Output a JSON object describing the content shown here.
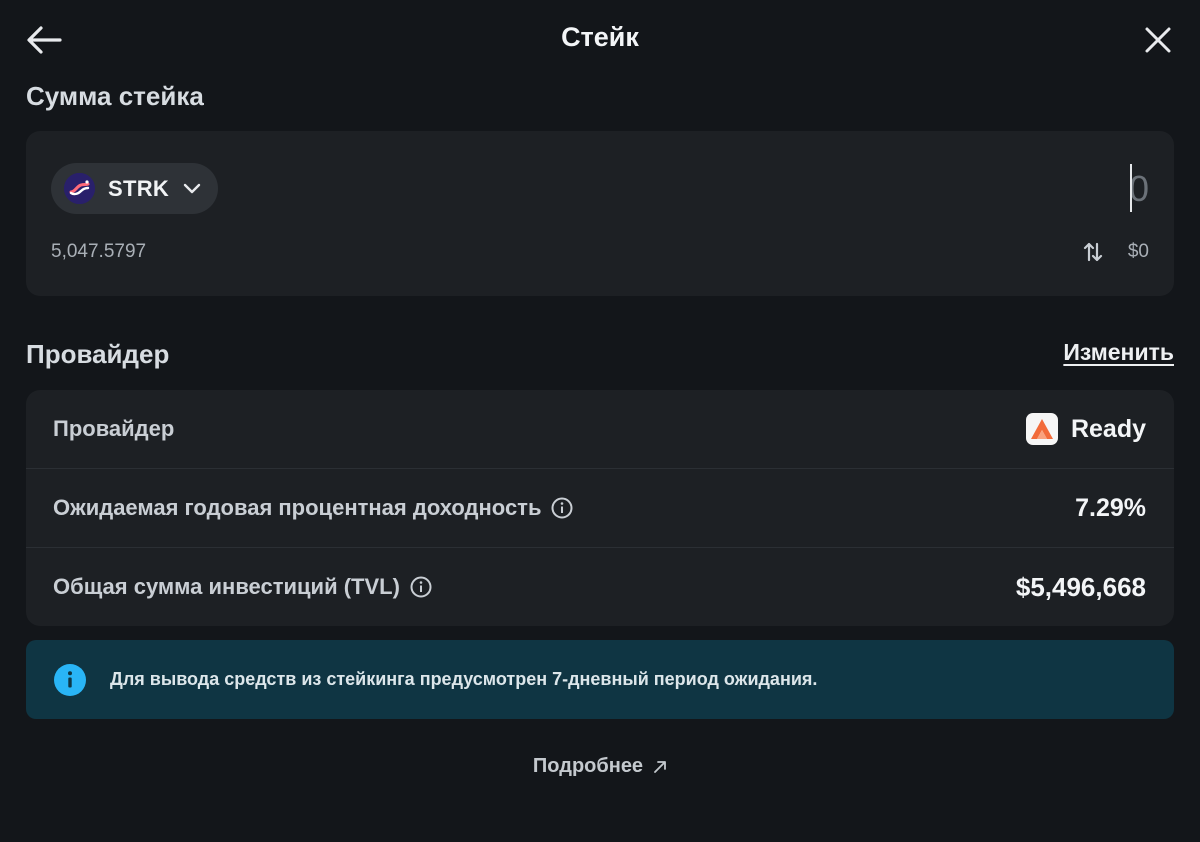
{
  "header": {
    "title": "Стейк",
    "back_icon": "arrow-left-icon",
    "close_icon": "close-icon"
  },
  "stake_amount": {
    "section_title": "Сумма стейка",
    "token": {
      "symbol": "STRK",
      "icon": "starknet-logo-icon"
    },
    "amount_placeholder": "0",
    "amount_value": "",
    "balance": "5,047.5797",
    "fiat_value": "$0",
    "swap_icon": "swap-vertical-icon"
  },
  "provider_section": {
    "section_title": "Провайдер",
    "change_label": "Изменить",
    "rows": [
      {
        "label": "Провайдер",
        "value": "Ready",
        "icon": "ready-logo-icon"
      },
      {
        "label": "Ожидаемая годовая процентная доходность",
        "value": "7.29%",
        "info_icon": "info-icon"
      },
      {
        "label": "Общая сумма инвестиций (TVL)",
        "value": "$5,496,668",
        "info_icon": "info-icon"
      }
    ]
  },
  "notice": {
    "icon": "info-icon",
    "text": "Для вывода средств из стейкинга предусмотрен 7-дневный период ожидания."
  },
  "more_link": {
    "label": "Подробнее",
    "icon": "external-arrow-icon"
  },
  "colors": {
    "background": "#13161a",
    "card": "#1d2024",
    "notice_bg": "#0f3543",
    "notice_icon": "#29b5f6",
    "ready_brand": "#f26b3a"
  }
}
